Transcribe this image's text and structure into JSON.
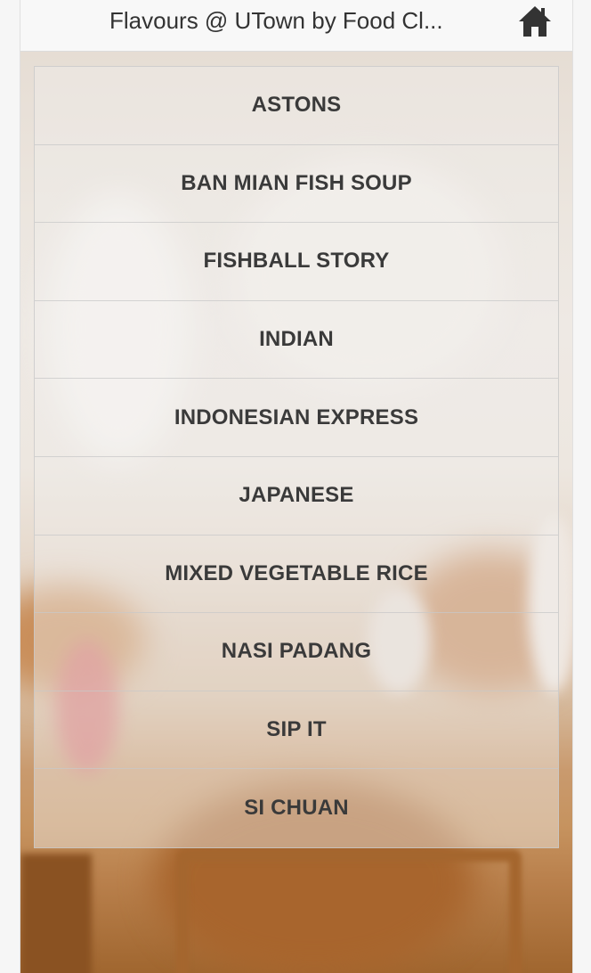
{
  "header": {
    "title": "Flavours @ UTown by Food Cl...",
    "home_icon": "home-icon"
  },
  "menu": {
    "items": [
      {
        "label": "ASTONS"
      },
      {
        "label": "BAN MIAN FISH SOUP"
      },
      {
        "label": "FISHBALL STORY"
      },
      {
        "label": "INDIAN"
      },
      {
        "label": "INDONESIAN EXPRESS"
      },
      {
        "label": "JAPANESE"
      },
      {
        "label": "MIXED VEGETABLE RICE"
      },
      {
        "label": "NASI PADANG"
      },
      {
        "label": "SIP IT"
      },
      {
        "label": "SI CHUAN"
      }
    ]
  }
}
